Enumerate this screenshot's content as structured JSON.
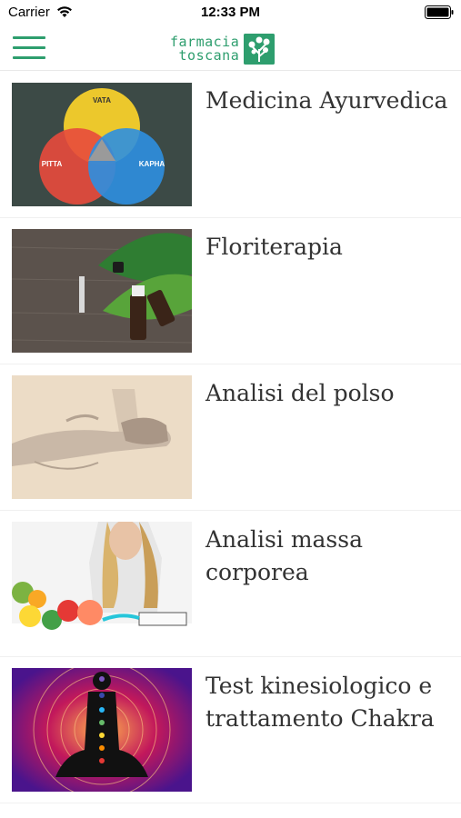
{
  "status_bar": {
    "carrier": "Carrier",
    "time": "12:33 PM"
  },
  "header": {
    "brand_line1": "farmacia",
    "brand_line2": "toscana",
    "accent_color": "#2e9e6e"
  },
  "list": {
    "items": [
      {
        "title": "Medicina Ayurvedica",
        "image": "ayurveda-doshas-diagram",
        "doshas": [
          "VATA",
          "PITTA",
          "KAPHA"
        ]
      },
      {
        "title": "Floriterapia",
        "image": "essential-oil-bottles-leaves"
      },
      {
        "title": "Analisi del polso",
        "image": "pulse-reading-hands"
      },
      {
        "title": "Analisi massa corporea",
        "image": "woman-healthy-food-measuring-tape"
      },
      {
        "title": "Test kinesiologico e trattamento Chakra",
        "image": "meditation-silhouette-chakras"
      }
    ]
  }
}
